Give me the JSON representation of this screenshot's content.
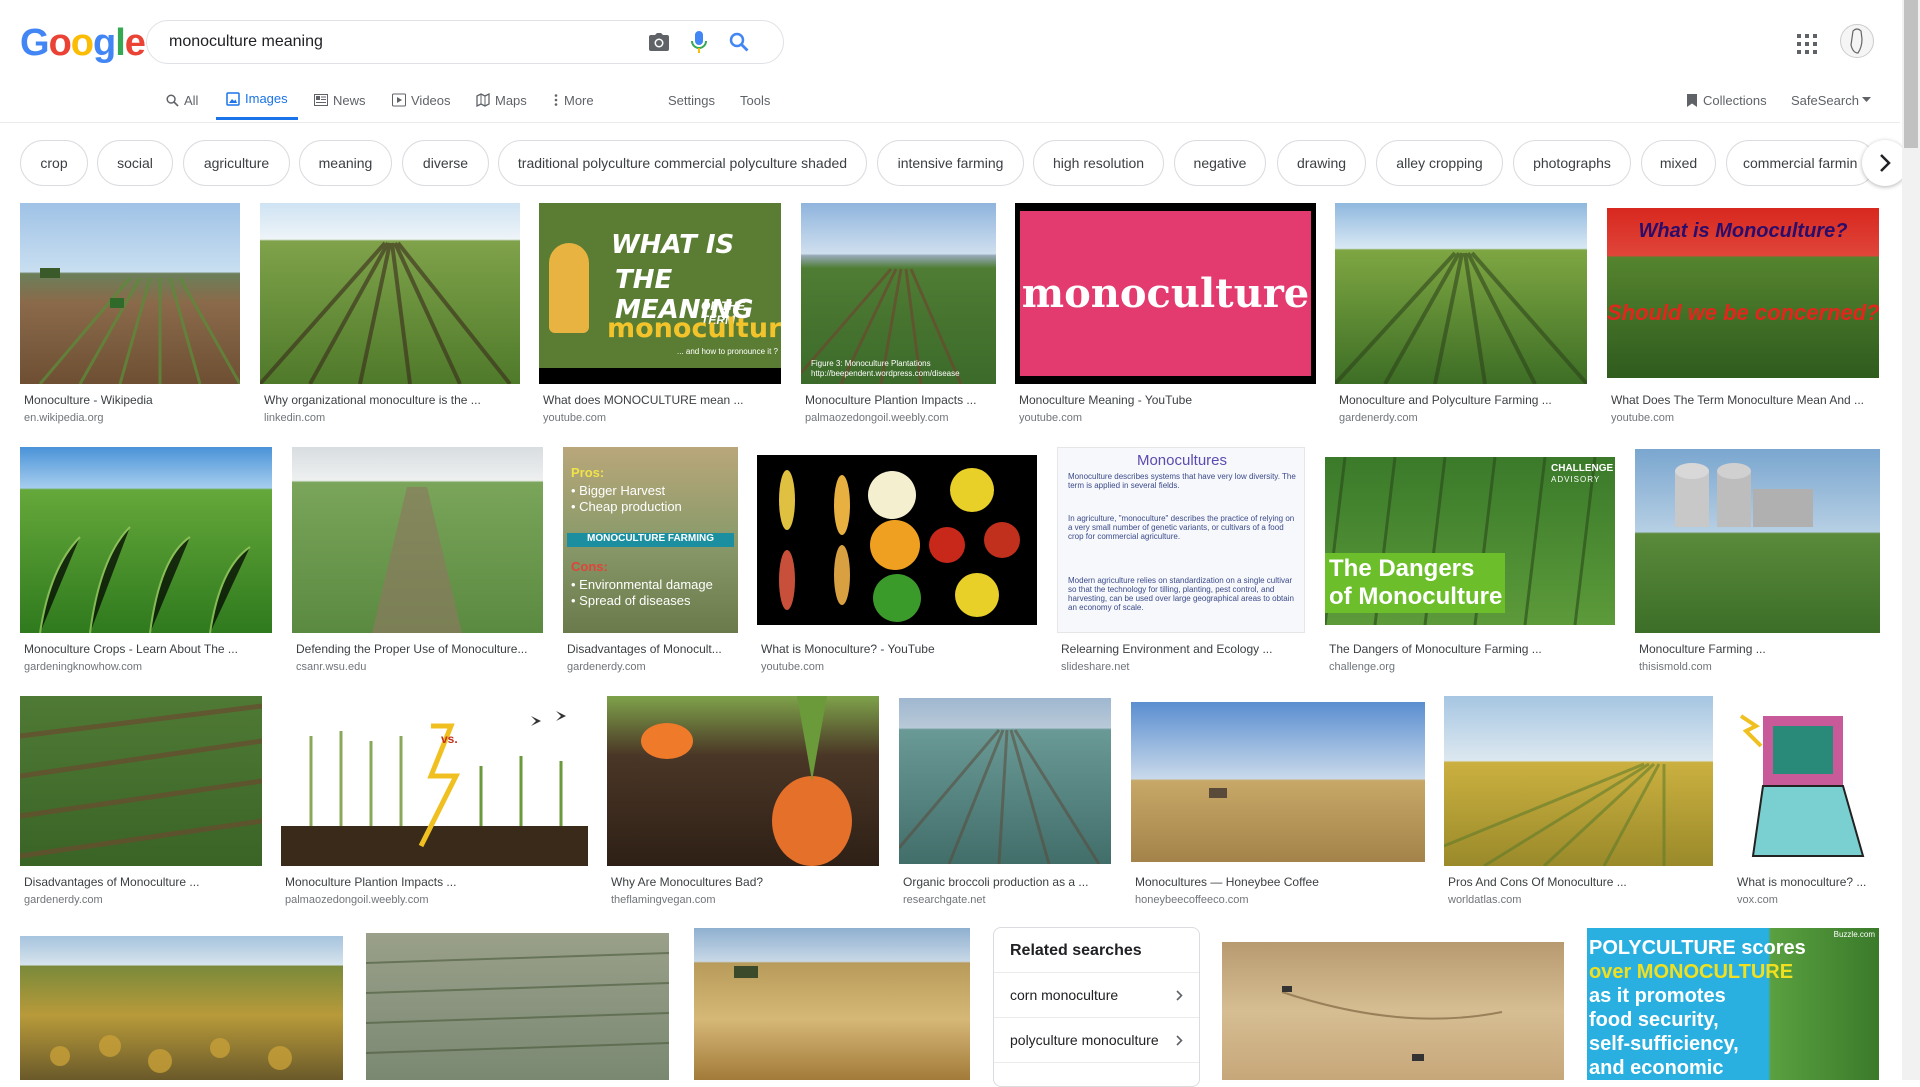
{
  "logo": {
    "letters": [
      "G",
      "o",
      "o",
      "g",
      "l",
      "e"
    ],
    "colors": [
      "#4285f4",
      "#ea4335",
      "#fbbc05",
      "#4285f4",
      "#34a853",
      "#ea4335"
    ]
  },
  "search": {
    "query": "monoculture meaning"
  },
  "nav": {
    "all": "All",
    "images": "Images",
    "news": "News",
    "videos": "Videos",
    "maps": "Maps",
    "more": "More",
    "settings": "Settings",
    "tools": "Tools",
    "collections": "Collections",
    "safesearch": "SafeSearch"
  },
  "chips": [
    "crop",
    "social",
    "agriculture",
    "meaning",
    "diverse",
    "traditional polyculture commercial polyculture shaded",
    "intensive farming",
    "high resolution",
    "negative",
    "drawing",
    "alley cropping",
    "photographs",
    "mixed",
    "commercial farmin"
  ],
  "results": [
    {
      "title": "Monoculture - Wikipedia",
      "source": "en.wikipedia.org"
    },
    {
      "title": "Why organizational monoculture is the ...",
      "source": "linkedin.com"
    },
    {
      "title": "What does MONOCULTURE mean ...",
      "source": "youtube.com",
      "overlay": [
        "WHAT IS",
        "THE MEANING",
        "OF THE TERM",
        "monoculture",
        "... and how to pronounce it ?"
      ]
    },
    {
      "title": "Monoculture Plantion Impacts ...",
      "source": "palmaozedongoil.weebly.com",
      "overlay": [
        "Figure 3: Monoculture Plantations",
        "http://beependent.wordpress.com/disease"
      ]
    },
    {
      "title": "Monoculture Meaning - YouTube",
      "source": "youtube.com",
      "overlay": [
        "monoculture"
      ]
    },
    {
      "title": "Monoculture and Polyculture Farming ...",
      "source": "gardenerdy.com"
    },
    {
      "title": "What Does The Term Monoculture Mean And ...",
      "source": "youtube.com",
      "overlay": [
        "What is Monoculture?",
        "Should we be concerned?"
      ]
    },
    {
      "title": "Monoculture Crops - Learn About The ...",
      "source": "gardeningknowhow.com"
    },
    {
      "title": "Defending the Proper Use of Monoculture...",
      "source": "csanr.wsu.edu"
    },
    {
      "title": "Disadvantages of Monocult...",
      "source": "gardenerdy.com",
      "overlay": [
        "Pros:",
        "• Bigger Harvest",
        "• Cheap production",
        "MONOCULTURE FARMING",
        "Cons:",
        "• Environmental damage",
        "• Spread of diseases"
      ]
    },
    {
      "title": "What is Monoculture? - YouTube",
      "source": "youtube.com"
    },
    {
      "title": "Relearning Environment and Ecology ...",
      "source": "slideshare.net",
      "overlay": [
        "Monocultures",
        "Monoculture describes systems that have very low diversity. The term is applied in several fields.",
        "In agriculture, \"monoculture\" describes the practice of relying on a very small number of genetic variants, or cultivars of a food crop for commercial agriculture.",
        "Modern agriculture relies on standardization on a single cultivar so that the technology for tilling, planting, pest control, and harvesting, can be used over large geographical areas to obtain an economy of scale."
      ]
    },
    {
      "title": "The Dangers of Monoculture Farming ...",
      "source": "challenge.org",
      "overlay": [
        "The Dangers",
        "of Monoculture",
        "CHALLENGE",
        "ADVISORY"
      ]
    },
    {
      "title": "Monoculture Farming ...",
      "source": "thisismold.com"
    },
    {
      "title": "Disadvantages of Monoculture ...",
      "source": "gardenerdy.com"
    },
    {
      "title": "Monoculture Plantion Impacts ...",
      "source": "palmaozedongoil.weebly.com",
      "overlay": [
        "vs."
      ]
    },
    {
      "title": "Why Are Monocultures Bad?",
      "source": "theflamingvegan.com"
    },
    {
      "title": "Organic broccoli production as a ...",
      "source": "researchgate.net"
    },
    {
      "title": "Monocultures — Honeybee Coffee",
      "source": "honeybeecoffeeco.com"
    },
    {
      "title": "Pros And Cons Of Monoculture ...",
      "source": "worldatlas.com"
    },
    {
      "title": "What is monoculture? ...",
      "source": "vox.com"
    },
    {
      "title": "",
      "source": ""
    },
    {
      "title": "",
      "source": ""
    },
    {
      "title": "",
      "source": ""
    },
    {
      "title": "",
      "source": ""
    },
    {
      "title": "",
      "source": "",
      "overlay": [
        "POLYCULTURE scores",
        "over MONOCULTURE",
        "as it promotes",
        "food security,",
        "self-sufficiency,",
        "and economic",
        "Buzzle.com"
      ]
    }
  ],
  "related": {
    "heading": "Related searches",
    "items": [
      "corn monoculture",
      "polyculture monoculture"
    ]
  }
}
